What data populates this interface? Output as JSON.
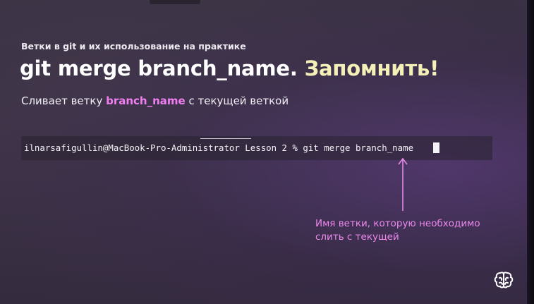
{
  "slide": {
    "subtitle": "Ветки в git и их использование на практике",
    "heading_main": "git merge branch_name.",
    "heading_accent": "Запомнить!",
    "desc_before": "Сливает ветку",
    "desc_highlight": "branch_name",
    "desc_after": "с текущей веткой"
  },
  "terminal": {
    "prompt_line": "ilnarsafigullin@MacBook-Pro-Administrator Lesson 2 % git merge branch_name"
  },
  "annotation": {
    "line1": "Имя ветки, которую необходимо",
    "line2": "слить с текущей"
  },
  "colors": {
    "accent_yellow": "#f4f0b8",
    "highlight_pink": "#f07ff0",
    "annotation_pink": "#ec88ec"
  },
  "icons": {
    "logo": "brain-logo-icon",
    "arrow": "arrow-up-icon"
  }
}
